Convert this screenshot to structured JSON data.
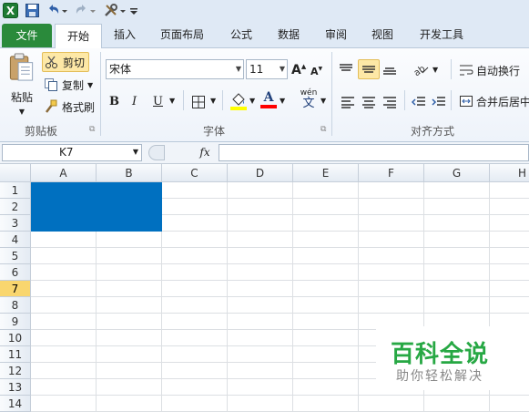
{
  "qat": {
    "undo_icon": "undo-icon",
    "redo_icon": "redo-icon",
    "save_icon": "save-icon"
  },
  "tabs": [
    {
      "label": "文件"
    },
    {
      "label": "开始"
    },
    {
      "label": "插入"
    },
    {
      "label": "页面布局"
    },
    {
      "label": "公式"
    },
    {
      "label": "数据"
    },
    {
      "label": "审阅"
    },
    {
      "label": "视图"
    },
    {
      "label": "开发工具"
    }
  ],
  "clipboard": {
    "paste": "粘贴",
    "cut": "剪切",
    "copy": "复制",
    "format_painter": "格式刷",
    "title": "剪贴板"
  },
  "font": {
    "name": "宋体",
    "size": "11",
    "bold": "B",
    "italic": "I",
    "underline": "U",
    "font_color_letter": "A",
    "grow": "A",
    "shrink": "A",
    "phonetic_top": "wén",
    "phonetic_bottom": "文",
    "title": "字体",
    "highlight_color": "#ffff00",
    "font_color": "#ff0000"
  },
  "alignment": {
    "wrap_text": "自动换行",
    "merge_center": "合并后居中",
    "title": "对齐方式"
  },
  "formula_bar": {
    "name_box": "K7",
    "fx": "fx",
    "formula": ""
  },
  "grid": {
    "columns": [
      "A",
      "B",
      "C",
      "D",
      "E",
      "F",
      "G",
      "H"
    ],
    "rows": [
      "1",
      "2",
      "3",
      "4",
      "5",
      "6",
      "7",
      "8",
      "9",
      "10",
      "11",
      "12",
      "13",
      "14"
    ],
    "active_row": "7",
    "fill_color": "#0070c0",
    "filled_range": "A1:B3"
  },
  "watermark": {
    "title": "百科全说",
    "subtitle": "助你轻松解决"
  },
  "colors": {
    "file_tab": "#2a8a3b",
    "ribbon_bg": "#dfe9f5",
    "selected_fill": "#0070c0"
  }
}
